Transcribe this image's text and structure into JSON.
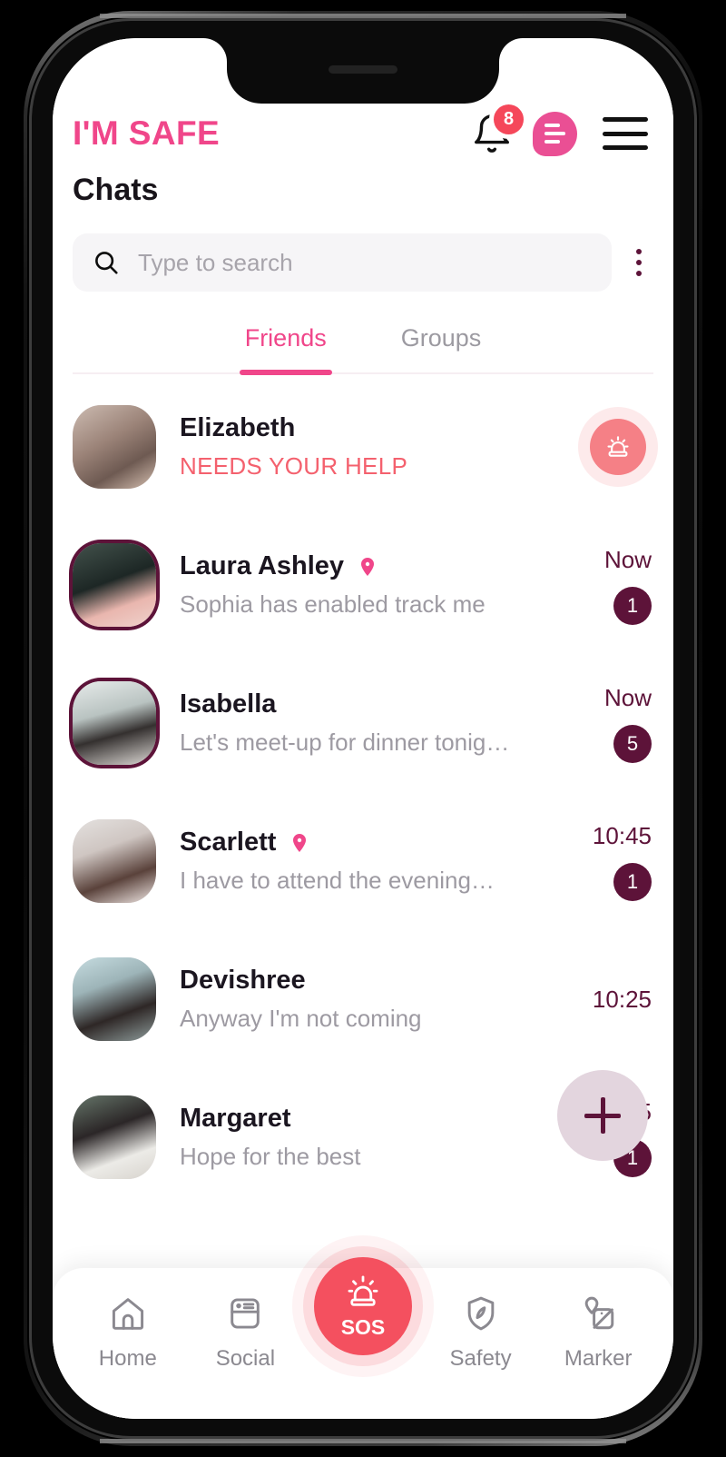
{
  "app": {
    "logo": "I'M SAFE",
    "page_title": "Chats"
  },
  "header": {
    "bell_icon": "notification-bell-icon",
    "bell_badge_count": "8",
    "messages_icon": "messages-bubble-icon",
    "menu_icon": "hamburger-menu-icon"
  },
  "search": {
    "icon": "search-icon",
    "placeholder": "Type to search",
    "value": "",
    "more_icon": "more-vertical-icon"
  },
  "tabs": [
    {
      "label": "Friends",
      "active": true
    },
    {
      "label": "Groups",
      "active": false
    }
  ],
  "chats": [
    {
      "name": "Elizabeth",
      "preview": "NEEDS YOUR HELP",
      "alert": true,
      "time": "",
      "badge": "",
      "location_pin": false,
      "action_icon": "siren-alert-icon",
      "avatar_ring": false,
      "avatar_colors": [
        "#b9a79c",
        "#6d5c54",
        "#d8c3b4"
      ]
    },
    {
      "name": "Laura Ashley",
      "preview": "Sophia has enabled track me",
      "alert": false,
      "time": "Now",
      "badge": "1",
      "location_pin": true,
      "action_icon": "",
      "avatar_ring": true,
      "avatar_colors": [
        "#3b4a45",
        "#18211f",
        "#e7b8b0"
      ]
    },
    {
      "name": "Isabella",
      "preview": "Let's meet-up for dinner tonig…",
      "alert": false,
      "time": "Now",
      "badge": "5",
      "location_pin": false,
      "action_icon": "",
      "avatar_ring": true,
      "avatar_colors": [
        "#dfe3e2",
        "#8e9a98",
        "#2d2a2c"
      ]
    },
    {
      "name": "Scarlett",
      "preview": "I have to attend the evening…",
      "alert": false,
      "time": "10:45",
      "badge": "1",
      "location_pin": true,
      "action_icon": "",
      "avatar_ring": false,
      "avatar_colors": [
        "#dedbd9",
        "#4a3530",
        "#efe2de"
      ]
    },
    {
      "name": "Devishree",
      "preview": "Anyway I'm not coming",
      "alert": false,
      "time": "10:25",
      "badge": "",
      "location_pin": false,
      "action_icon": "",
      "avatar_ring": false,
      "avatar_colors": [
        "#b9d2d6",
        "#2b2423",
        "#8d9b9a"
      ]
    },
    {
      "name": "Margaret",
      "preview": "Hope for the best",
      "alert": false,
      "time": "10:25",
      "badge": "1",
      "location_pin": false,
      "action_icon": "",
      "avatar_ring": false,
      "avatar_colors": [
        "#5b6b5e",
        "#262223",
        "#e6e4e0"
      ]
    }
  ],
  "fab": {
    "icon": "plus-icon",
    "label": "+"
  },
  "bottom_nav": [
    {
      "label": "Home",
      "icon": "home-icon",
      "active": false
    },
    {
      "label": "Social",
      "icon": "feed-card-icon",
      "active": false
    },
    {
      "label": "SOS",
      "icon": "siren-icon",
      "active": true
    },
    {
      "label": "Safety",
      "icon": "shield-leaf-icon",
      "active": false
    },
    {
      "label": "Marker",
      "icon": "map-marker-icon",
      "active": false
    }
  ],
  "colors": {
    "brand_pink": "#f0468a",
    "alert_red": "#f4505f",
    "dark_purple": "#5d1339",
    "badge_red": "#f5475a",
    "muted_gray": "#9d9aa2"
  }
}
